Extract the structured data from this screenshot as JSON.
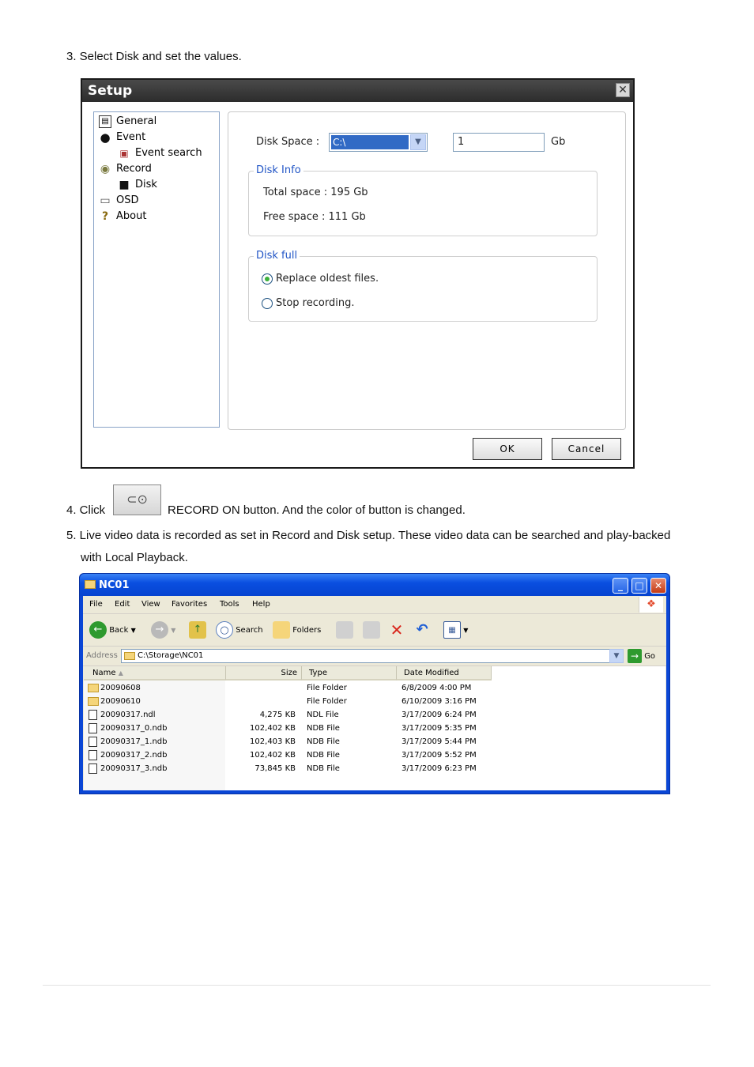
{
  "steps": {
    "step3": "3. Select Disk and set the values.",
    "step4_prefix": "4. Click",
    "step4_suffix": "RECORD ON button. And the color of button is changed.",
    "step5_line1": "5. Live video data is recorded as set in Record and Disk setup. These video data can be searched and play-backed",
    "step5_line2": "with Local Playback."
  },
  "setup": {
    "title": "Setup",
    "close": "✕",
    "tree": [
      {
        "label": "General",
        "icon": "general-icon",
        "glyph": "▤"
      },
      {
        "label": "Event",
        "icon": "bomb-icon",
        "glyph": "●"
      },
      {
        "label": "Event search",
        "icon": "event-search-icon",
        "glyph": "▣"
      },
      {
        "label": "Record",
        "icon": "record-icon",
        "glyph": "◉"
      },
      {
        "label": "Disk",
        "icon": "disk-icon",
        "glyph": "■"
      },
      {
        "label": "OSD",
        "icon": "osd-icon",
        "glyph": "▭"
      },
      {
        "label": "About",
        "icon": "question-icon",
        "glyph": "?"
      }
    ],
    "disk_space_label": "Disk Space :",
    "disk_value": "C:\\",
    "size_value": "1",
    "unit": "Gb",
    "disk_info": {
      "title": "Disk Info",
      "total": "Total space : 195 Gb",
      "free": "Free space : 111 Gb"
    },
    "disk_full": {
      "title": "Disk full",
      "options": [
        {
          "label": "Replace oldest files.",
          "selected": true
        },
        {
          "label": "Stop recording.",
          "selected": false
        }
      ]
    },
    "ok": "OK",
    "cancel": "Cancel"
  },
  "record_button_icon": "record-on-icon",
  "explorer": {
    "title": "NC01",
    "menu": [
      "File",
      "Edit",
      "View",
      "Favorites",
      "Tools",
      "Help"
    ],
    "toolbar": {
      "back": "Back",
      "search": "Search",
      "folders": "Folders"
    },
    "address_label": "Address",
    "address": "C:\\Storage\\NC01",
    "go": "Go",
    "columns": {
      "name": "Name",
      "size": "Size",
      "type": "Type",
      "date": "Date Modified"
    },
    "rows": [
      {
        "name": "20090608",
        "size": "",
        "type": "File Folder",
        "date": "6/8/2009 4:00 PM",
        "kind": "folder"
      },
      {
        "name": "20090610",
        "size": "",
        "type": "File Folder",
        "date": "6/10/2009 3:16 PM",
        "kind": "folder"
      },
      {
        "name": "20090317.ndl",
        "size": "4,275 KB",
        "type": "NDL File",
        "date": "3/17/2009 6:24 PM",
        "kind": "file"
      },
      {
        "name": "20090317_0.ndb",
        "size": "102,402 KB",
        "type": "NDB File",
        "date": "3/17/2009 5:35 PM",
        "kind": "file"
      },
      {
        "name": "20090317_1.ndb",
        "size": "102,403 KB",
        "type": "NDB File",
        "date": "3/17/2009 5:44 PM",
        "kind": "file"
      },
      {
        "name": "20090317_2.ndb",
        "size": "102,402 KB",
        "type": "NDB File",
        "date": "3/17/2009 5:52 PM",
        "kind": "file"
      },
      {
        "name": "20090317_3.ndb",
        "size": "73,845 KB",
        "type": "NDB File",
        "date": "3/17/2009 6:23 PM",
        "kind": "file"
      }
    ]
  }
}
